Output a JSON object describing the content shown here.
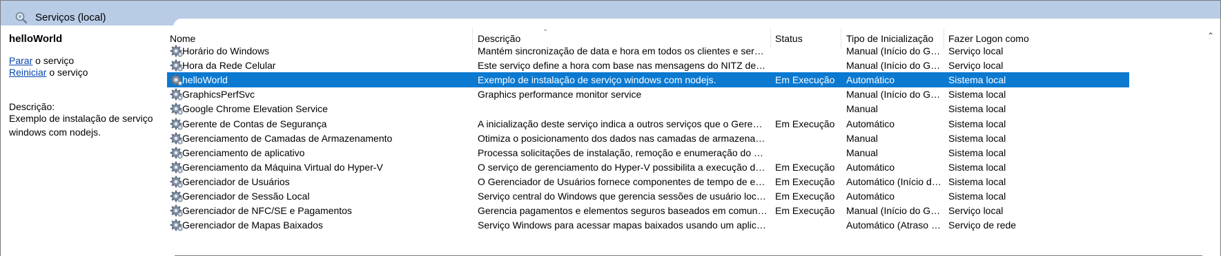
{
  "window": {
    "title": "Serviços (local)",
    "icon": "magnifier-gear-icon"
  },
  "left_pane": {
    "service_name": "helloWorld",
    "stop_link": "Parar",
    "stop_suffix": " o serviço",
    "restart_link": "Reiniciar",
    "restart_suffix": " o serviço",
    "description_label": "Descrição:",
    "description_text": "Exemplo de instalação de serviço windows com nodejs."
  },
  "columns": {
    "name": "Nome",
    "description": "Descrição",
    "status": "Status",
    "startup": "Tipo de Inicialização",
    "logon": "Fazer Logon como"
  },
  "rows": [
    {
      "name": "Horário do Windows",
      "description": "Mantém sincronização de data e hora em todos os clientes e servidores...",
      "status": "",
      "startup": "Manual (Início do Gat...",
      "logon": "Serviço local"
    },
    {
      "name": "Hora da Rede Celular",
      "description": "Este serviço define a hora com base nas mensagens do NITZ de uma re...",
      "status": "",
      "startup": "Manual (Início do Gat...",
      "logon": "Serviço local"
    },
    {
      "name": "helloWorld",
      "description": "Exemplo de instalação de serviço windows com nodejs.",
      "status": "Em Execução",
      "startup": "Automático",
      "logon": "Sistema local",
      "selected": true
    },
    {
      "name": "GraphicsPerfSvc",
      "description": "Graphics performance monitor service",
      "status": "",
      "startup": "Manual (Início do Gat...",
      "logon": "Sistema local"
    },
    {
      "name": "Google Chrome Elevation Service",
      "description": "",
      "status": "",
      "startup": "Manual",
      "logon": "Sistema local"
    },
    {
      "name": "Gerente de Contas de Segurança",
      "description": "A inicialização deste serviço indica a outros serviços que o Gerente de C...",
      "status": "Em Execução",
      "startup": "Automático",
      "logon": "Sistema local"
    },
    {
      "name": "Gerenciamento de Camadas de Armazenamento",
      "description": "Otimiza o posicionamento dos dados nas camadas de armazenamento ...",
      "status": "",
      "startup": "Manual",
      "logon": "Sistema local"
    },
    {
      "name": "Gerenciamento de aplicativo",
      "description": "Processa solicitações de instalação, remoção e enumeração do software...",
      "status": "",
      "startup": "Manual",
      "logon": "Sistema local"
    },
    {
      "name": "Gerenciamento da Máquina Virtual do Hyper-V",
      "description": "O serviço de gerenciamento do Hyper-V possibilita a execução de vária...",
      "status": "Em Execução",
      "startup": "Automático",
      "logon": "Sistema local"
    },
    {
      "name": "Gerenciador de Usuários",
      "description": "O Gerenciador de Usuários fornece componentes de tempo de execuçã...",
      "status": "Em Execução",
      "startup": "Automático (Início do...",
      "logon": "Sistema local"
    },
    {
      "name": "Gerenciador de Sessão Local",
      "description": "Serviço central do Windows que gerencia sessões de usuário local. Se e...",
      "status": "Em Execução",
      "startup": "Automático",
      "logon": "Sistema local"
    },
    {
      "name": "Gerenciador de NFC/SE e Pagamentos",
      "description": "Gerencia pagamentos e elementos seguros baseados em comunicação ...",
      "status": "Em Execução",
      "startup": "Manual (Início do Gat...",
      "logon": "Serviço local"
    },
    {
      "name": "Gerenciador de Mapas Baixados",
      "description": "Serviço Windows para acessar mapas baixados usando um aplicativo. E...",
      "status": "",
      "startup": "Automático (Atraso n...",
      "logon": "Serviço de rede"
    }
  ],
  "colors": {
    "selection": "#0b79d0",
    "titlebar": "#b9cce6",
    "link": "#0645ad"
  }
}
